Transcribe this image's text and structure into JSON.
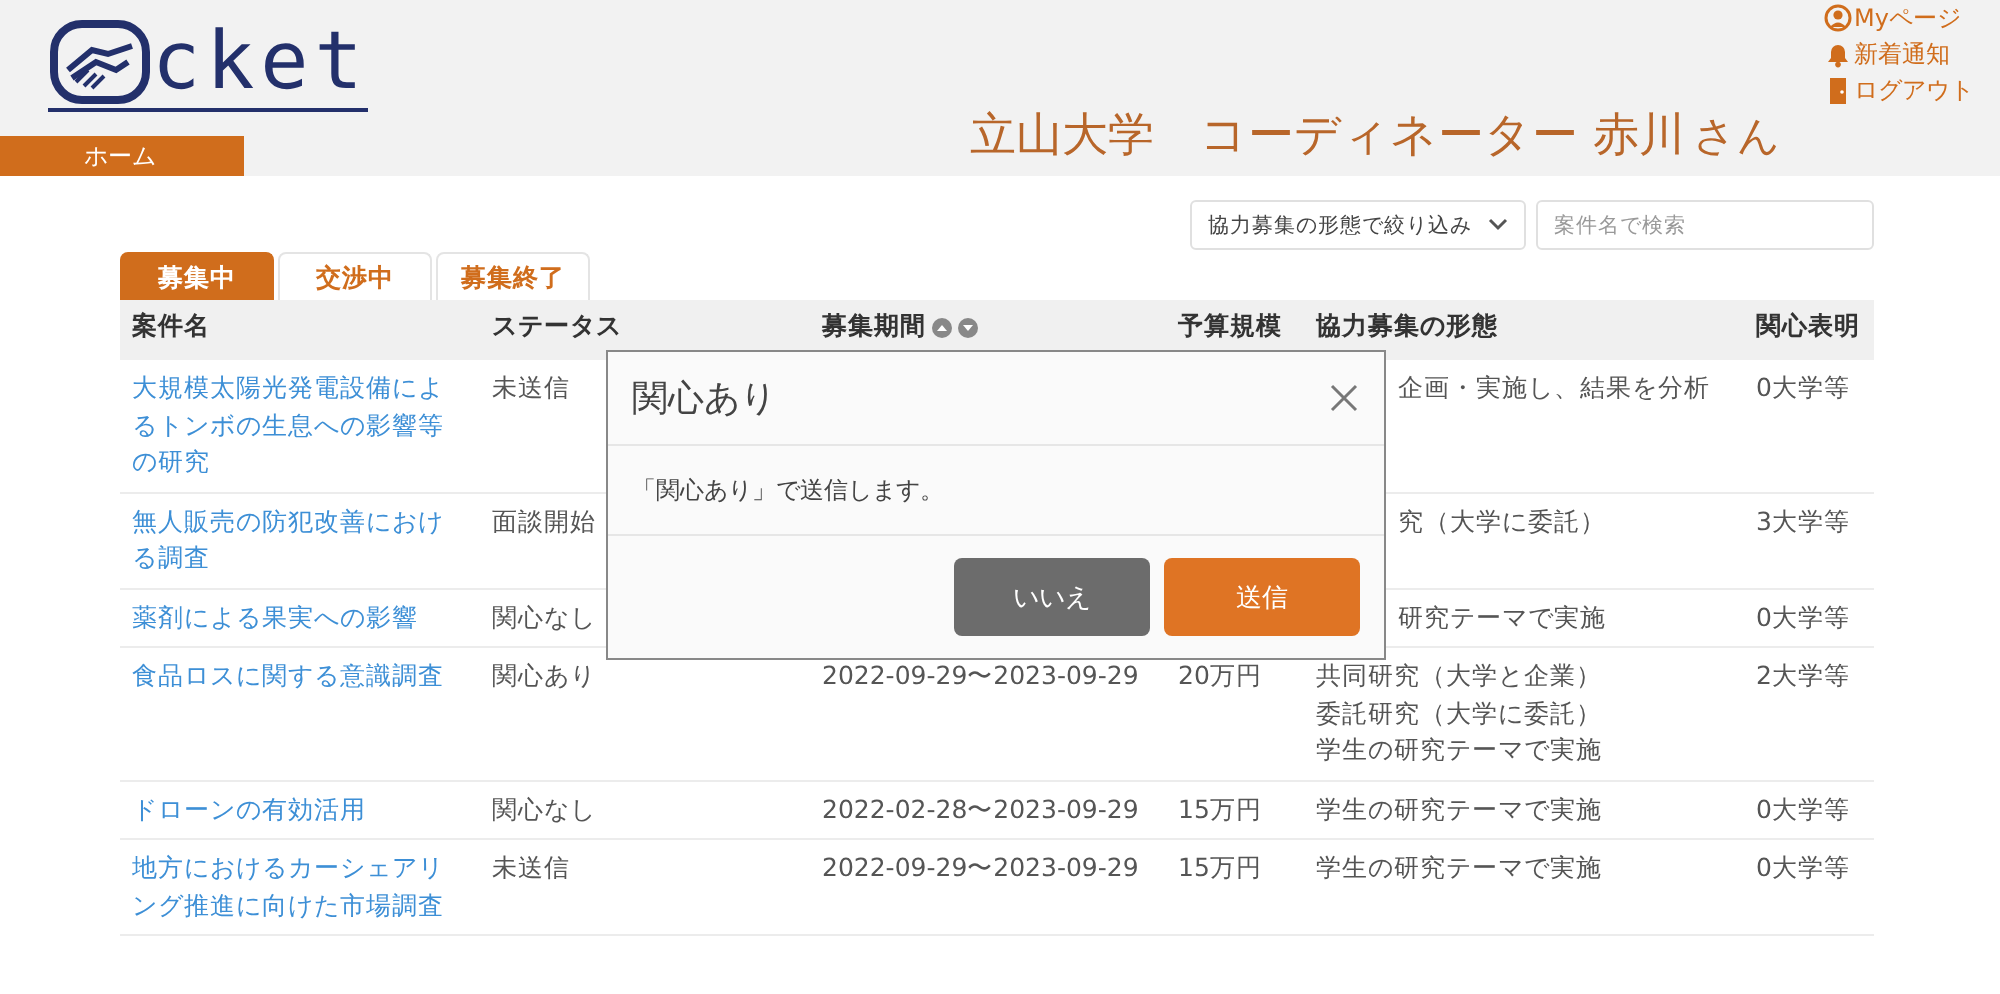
{
  "logo": {
    "text": "cket"
  },
  "nav": {
    "home": "ホーム"
  },
  "heading": {
    "main": "立山大学　コーディネーター 赤川",
    "suffix": "さん"
  },
  "user_links": [
    {
      "kind": "user",
      "label": "Myページ"
    },
    {
      "kind": "bell",
      "label": "新着通知"
    },
    {
      "kind": "door",
      "label": "ログアウト"
    }
  ],
  "filter": {
    "label": "協力募集の形態で絞り込み"
  },
  "search": {
    "placeholder": "案件名で検索"
  },
  "tabs": [
    {
      "label": "募集中",
      "selected": true
    },
    {
      "label": "交渉中",
      "selected": false
    },
    {
      "label": "募集終了",
      "selected": false
    }
  ],
  "table": {
    "columns": [
      {
        "label": "案件名",
        "kind": "plain"
      },
      {
        "label": "ステータス",
        "kind": "plain"
      },
      {
        "label": "募集期間",
        "kind": "sortable"
      },
      {
        "label": "予算規模",
        "kind": "plain"
      },
      {
        "label": "協力募集の形態",
        "kind": "plain"
      },
      {
        "label": "関心表明",
        "kind": "plain"
      }
    ],
    "rows": [
      {
        "name": "大規模太陽光発電設備によるトンボの生息への影響等の研究",
        "status": "未送信",
        "forms": [
          "企画・実施し、結果を分析"
        ],
        "kind": "partly_hidden",
        "interest": "0大学等"
      },
      {
        "name": "無人販売の防犯改善における調査",
        "status": "面談開始",
        "forms": [
          "究（大学に委託）"
        ],
        "kind": "partly_hidden",
        "interest": "3大学等"
      },
      {
        "name": "薬剤による果実への影響",
        "status": "関心なし",
        "forms": [
          "研究テーマで実施"
        ],
        "kind": "partly_hidden",
        "interest": "0大学等"
      },
      {
        "name": "食品ロスに関する意識調査",
        "status": "関心あり",
        "period": "2022-09-29〜2023-09-29",
        "budget": "20万円",
        "forms": [
          "共同研究（大学と企業）",
          "委託研究（大学に委託）",
          "学生の研究テーマで実施"
        ],
        "kind": "full",
        "interest": "2大学等"
      },
      {
        "name": "ドローンの有効活用",
        "status": "関心なし",
        "period": "2022-02-28〜2023-09-29",
        "budget": "15万円",
        "forms": [
          "学生の研究テーマで実施"
        ],
        "kind": "full",
        "interest": "0大学等"
      },
      {
        "name": "地方におけるカーシェアリング推進に向けた市場調査",
        "status": "未送信",
        "period": "2022-09-29〜2023-09-29",
        "budget": "15万円",
        "forms": [
          "学生の研究テーマで実施"
        ],
        "kind": "full",
        "interest": "0大学等"
      }
    ]
  },
  "dialog": {
    "title": "関心あり",
    "message": "「関心あり」で送信します。",
    "buttons": [
      {
        "kind": "cancel",
        "label": "いいえ"
      },
      {
        "kind": "primary",
        "label": "送信"
      }
    ]
  }
}
